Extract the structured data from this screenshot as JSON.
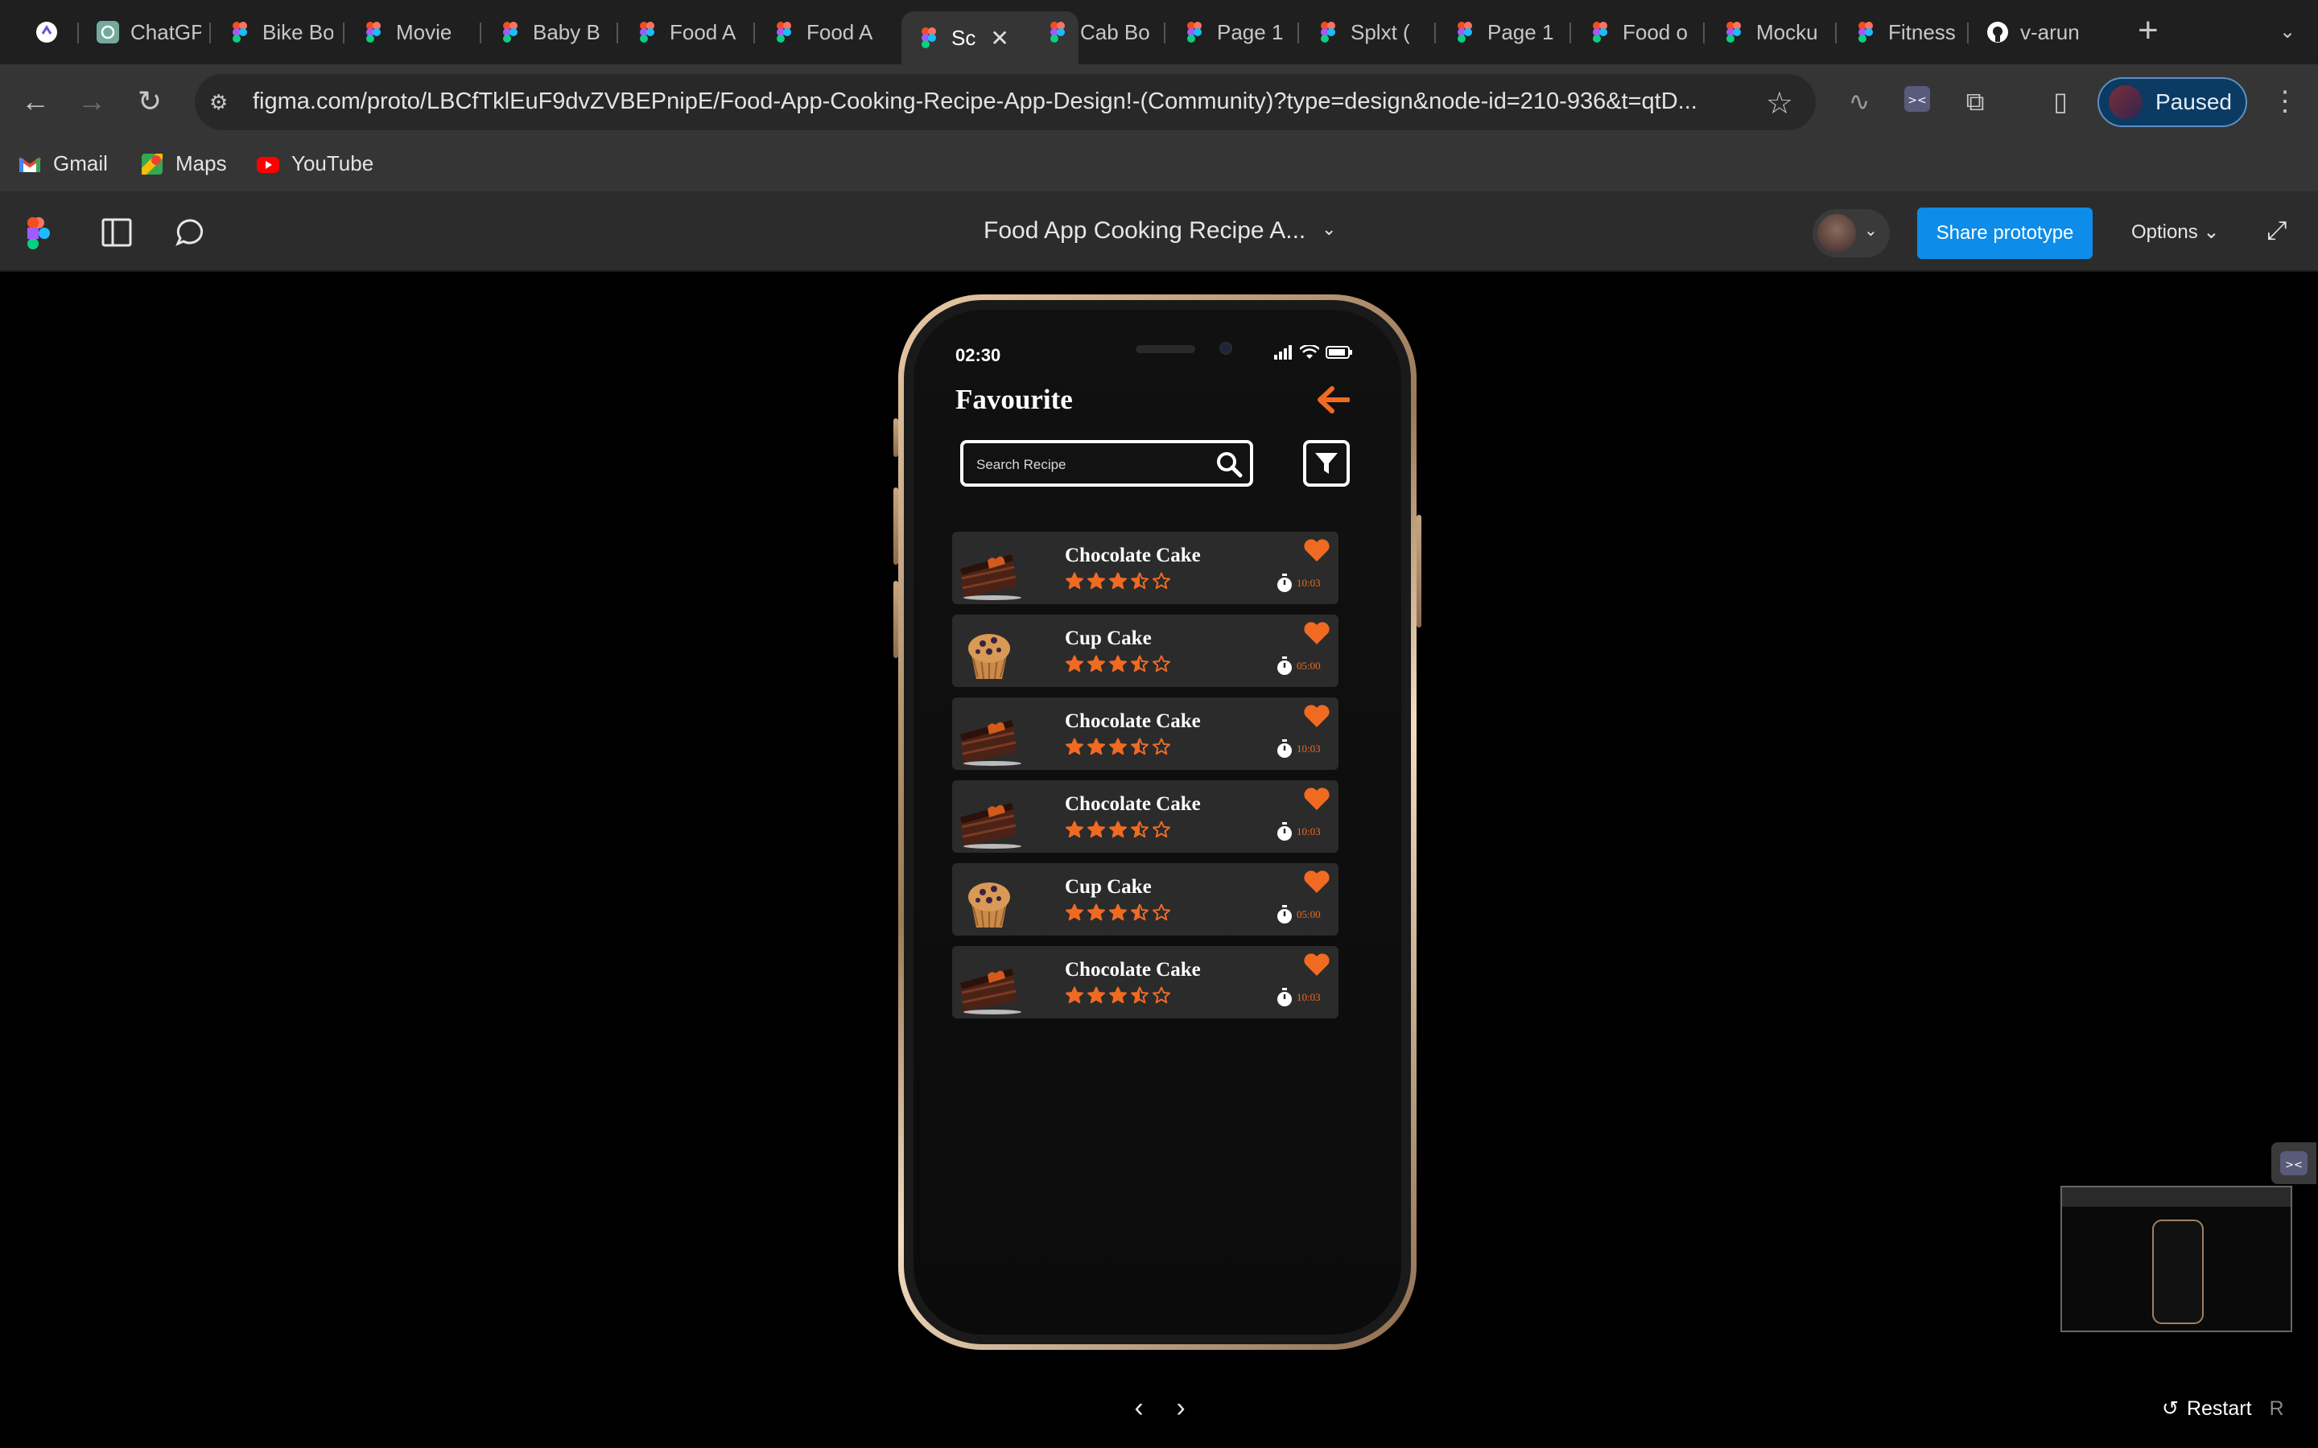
{
  "browser": {
    "tabs": [
      {
        "label": "",
        "icon": "arc-icon"
      },
      {
        "label": "ChatGPT",
        "icon": "chatgpt-icon"
      },
      {
        "label": "Bike Bo",
        "icon": "figma-icon"
      },
      {
        "label": "Movie",
        "icon": "figma-icon"
      },
      {
        "label": "Baby B",
        "icon": "figma-icon"
      },
      {
        "label": "Food A",
        "icon": "figma-icon"
      },
      {
        "label": "Food A",
        "icon": "figma-icon"
      },
      {
        "label": "Sc",
        "icon": "figma-icon",
        "active": true
      },
      {
        "label": "Cab Bo",
        "icon": "figma-icon"
      },
      {
        "label": "Page 1",
        "icon": "figma-icon"
      },
      {
        "label": "Splxt (",
        "icon": "figma-icon"
      },
      {
        "label": "Page 1",
        "icon": "figma-icon"
      },
      {
        "label": "Food o",
        "icon": "figma-icon"
      },
      {
        "label": "Mocku",
        "icon": "figma-icon"
      },
      {
        "label": "Fitness",
        "icon": "figma-icon"
      },
      {
        "label": "v-arun",
        "icon": "github-icon"
      }
    ],
    "url": "figma.com/proto/LBCfTklEuF9dvZVBEPnipE/Food-App-Cooking-Recipe-App-Design!-(Community)?type=design&node-id=210-936&t=qtD...",
    "profile_status": "Paused",
    "bookmarks": [
      {
        "label": "Gmail",
        "icon": "gmail-icon"
      },
      {
        "label": "Maps",
        "icon": "maps-icon"
      },
      {
        "label": "YouTube",
        "icon": "youtube-icon"
      }
    ]
  },
  "figma": {
    "file_title": "Food App Cooking Recipe A...",
    "share_label": "Share prototype",
    "options_label": "Options",
    "restart_label": "Restart",
    "restart_key": "R",
    "accent": "#0d8ce9"
  },
  "app": {
    "status_time": "02:30",
    "title": "Favourite",
    "search_placeholder": "Search Recipe",
    "accent": "#f06a22",
    "recipes": [
      {
        "name": "Chocolate Cake",
        "rating": 3.5,
        "time": "10:03",
        "image": "chocolate-cake"
      },
      {
        "name": "Cup Cake",
        "rating": 3.5,
        "time": "05:00",
        "image": "cup-cake"
      },
      {
        "name": "Chocolate Cake",
        "rating": 3.5,
        "time": "10:03",
        "image": "chocolate-cake"
      },
      {
        "name": "Chocolate Cake",
        "rating": 3.5,
        "time": "10:03",
        "image": "chocolate-cake"
      },
      {
        "name": "Cup Cake",
        "rating": 3.5,
        "time": "05:00",
        "image": "cup-cake"
      },
      {
        "name": "Chocolate Cake",
        "rating": 3.5,
        "time": "10:03",
        "image": "chocolate-cake"
      }
    ]
  }
}
